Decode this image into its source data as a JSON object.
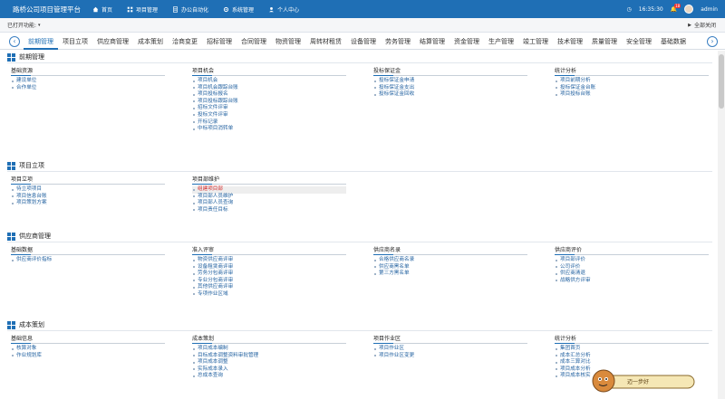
{
  "app": {
    "title": "路桥公司项目管理平台"
  },
  "topnav": [
    {
      "label": "首页"
    },
    {
      "label": "项目管理"
    },
    {
      "label": "办公自动化"
    },
    {
      "label": "系统管理"
    },
    {
      "label": "个人中心"
    }
  ],
  "topright": {
    "time": "16:35:30",
    "badge": "18",
    "user": "admin"
  },
  "openbar": {
    "label": "已打开功能:",
    "close_all": "全部关闭"
  },
  "tabs": [
    "前期管理",
    "项目立项",
    "供应商管理",
    "成本策划",
    "洽商变更",
    "招标管理",
    "合同管理",
    "物资管理",
    "周转材租赁",
    "设备管理",
    "劳务管理",
    "结算管理",
    "资金管理",
    "生产管理",
    "竣工管理",
    "技术管理",
    "质量管理",
    "安全管理",
    "基础数据"
  ],
  "sections": [
    {
      "title": "前期管理",
      "columns": [
        {
          "title": "基础资源",
          "items": [
            "建设单位",
            "合作单位"
          ]
        },
        {
          "title": "项目机会",
          "items": [
            "项目机会",
            "项目机会跟踪台账",
            "项目投标报名",
            "项目投标跟踪台账",
            "招标文件评审",
            "投标文件评审",
            "开标记录",
            "中标项目消转单"
          ]
        },
        {
          "title": "投标保证金",
          "items": [
            "投标保证金申请",
            "投标保证金支出",
            "投标保证金回收"
          ]
        },
        {
          "title": "统计分析",
          "items": [
            "项目前期分析",
            "投标保证金台账",
            "项目投标台账"
          ]
        }
      ]
    },
    {
      "title": "项目立项",
      "columns": [
        {
          "title": "项目立项",
          "items": [
            "待立项项目",
            "项目信息台账",
            "项目策划方案"
          ]
        },
        {
          "title": "项目部维护",
          "items": [
            "组建项目部",
            "项目部人员维护",
            "项目部人员查询",
            "项目责任目标"
          ]
        }
      ]
    },
    {
      "title": "供应商管理",
      "columns": [
        {
          "title": "基础数据",
          "items": [
            "供应商评价指标"
          ]
        },
        {
          "title": "准入评审",
          "items": [
            "物资供应商评审",
            "设备租赁商评审",
            "劳务分包商评审",
            "专业分包商评审",
            "其他供应商评审",
            "专项作业区域"
          ]
        },
        {
          "title": "供应商名录",
          "items": [
            "合格供应商名录",
            "供应商黑名单",
            "第三方黑名单"
          ]
        },
        {
          "title": "供应商评价",
          "items": [
            "项目部评价",
            "公司评价",
            "供应商清退",
            "战略供方评审"
          ]
        }
      ]
    },
    {
      "title": "成本策划",
      "columns": [
        {
          "title": "基础信息",
          "items": [
            "核算对象",
            "作业规划库"
          ]
        },
        {
          "title": "成本策划",
          "items": [
            "项目成本编制",
            "目标成本调整资料审批管理",
            "项目成本调整",
            "实际成本录入",
            "总成本查询"
          ]
        },
        {
          "title": "项目作业区",
          "items": [
            "项目作业区",
            "项目作业区变更"
          ]
        },
        {
          "title": "统计分析",
          "items": [
            "集团首页",
            "成本汇总分析",
            "成本三算对比",
            "项目成本分析",
            "项目成本核实"
          ]
        }
      ]
    }
  ],
  "mascot": {
    "text": "迈一步好"
  }
}
